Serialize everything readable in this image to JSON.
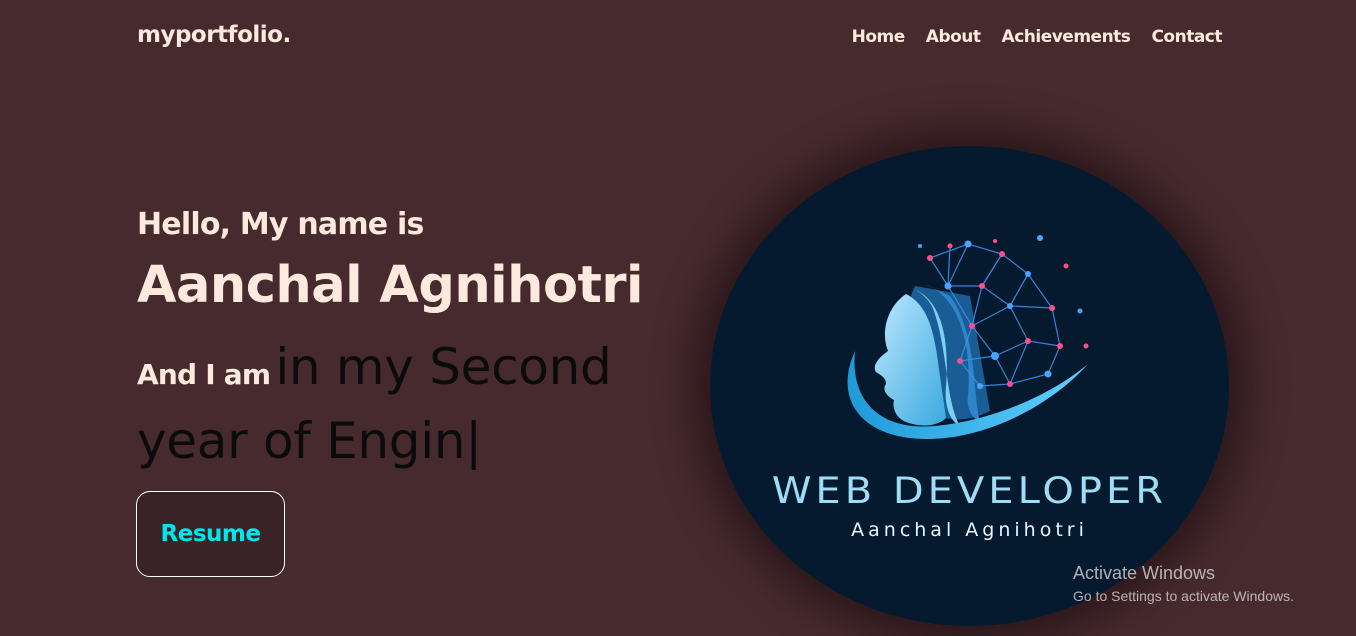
{
  "header": {
    "brand": "myportfolio.",
    "nav": [
      {
        "label": "Home"
      },
      {
        "label": "About"
      },
      {
        "label": "Achievements"
      },
      {
        "label": "Contact"
      }
    ]
  },
  "hero": {
    "greeting": "Hello, My name is",
    "name": "Aanchal Agnihotri",
    "role_prefix": "And I am",
    "typed_line1": "in my Second",
    "typed_line2": "year of Engin",
    "cursor": "|",
    "resume_label": "Resume"
  },
  "logo": {
    "title": "WEB DEVELOPER",
    "subtitle": "Aanchal Agnihotri",
    "icon": "head-network-icon"
  },
  "watermark": {
    "line1": "Activate Windows",
    "line2": "Go to Settings to activate Windows."
  },
  "colors": {
    "background": "#472a2d",
    "text_light": "#fde9dd",
    "accent_cyan": "#00e6ee",
    "logo_bg": "#051a2e"
  }
}
